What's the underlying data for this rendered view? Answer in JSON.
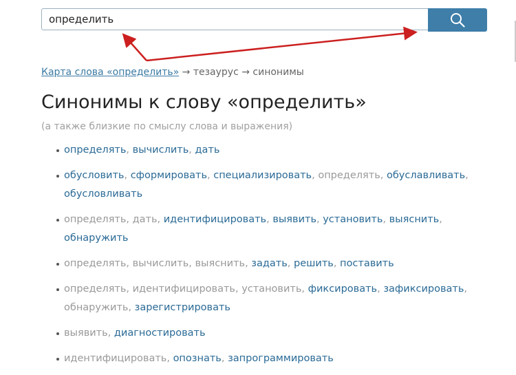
{
  "search": {
    "value": "определить"
  },
  "breadcrumb": {
    "link": "Карта слова «определить»",
    "arrow": "→",
    "item1": "тезаурус",
    "item2": "синонимы"
  },
  "title": "Синонимы к слову «определить»",
  "subtitle": "(а также близкие по смыслу слова и выражения)",
  "colors": {
    "link": "#2a6a96",
    "muted": "#999999",
    "search_button": "#3e7ea9",
    "annotation_arrow": "#cc1f1f"
  },
  "icons": {
    "search_button": "search-icon"
  },
  "synonyms": [
    [
      {
        "text": "определять",
        "link": true
      },
      {
        "text": "вычислить",
        "link": true
      },
      {
        "text": "дать",
        "link": true
      }
    ],
    [
      {
        "text": "обусловить",
        "link": true
      },
      {
        "text": "сформировать",
        "link": true
      },
      {
        "text": "специализировать",
        "link": true
      },
      {
        "text": "определять",
        "link": false
      },
      {
        "text": "обуславливать",
        "link": true
      },
      {
        "text": "обусловливать",
        "link": true
      }
    ],
    [
      {
        "text": "определять",
        "link": false
      },
      {
        "text": "дать",
        "link": false
      },
      {
        "text": "идентифицировать",
        "link": true
      },
      {
        "text": "выявить",
        "link": true
      },
      {
        "text": "установить",
        "link": true
      },
      {
        "text": "выяснить",
        "link": true
      },
      {
        "text": "обнаружить",
        "link": true
      }
    ],
    [
      {
        "text": "определять",
        "link": false
      },
      {
        "text": "вычислить",
        "link": false
      },
      {
        "text": "выяснить",
        "link": false
      },
      {
        "text": "задать",
        "link": true
      },
      {
        "text": "решить",
        "link": true
      },
      {
        "text": "поставить",
        "link": true
      }
    ],
    [
      {
        "text": "определять",
        "link": false
      },
      {
        "text": "идентифицировать",
        "link": false
      },
      {
        "text": "установить",
        "link": false
      },
      {
        "text": "фиксировать",
        "link": true
      },
      {
        "text": "зафиксировать",
        "link": true
      },
      {
        "text": "обнаружить",
        "link": false
      },
      {
        "text": "зарегистрировать",
        "link": true
      }
    ],
    [
      {
        "text": "выявить",
        "link": false
      },
      {
        "text": "диагностировать",
        "link": true
      }
    ],
    [
      {
        "text": "идентифицировать",
        "link": false
      },
      {
        "text": "опознать",
        "link": true
      },
      {
        "text": "запрограммировать",
        "link": true
      }
    ]
  ]
}
